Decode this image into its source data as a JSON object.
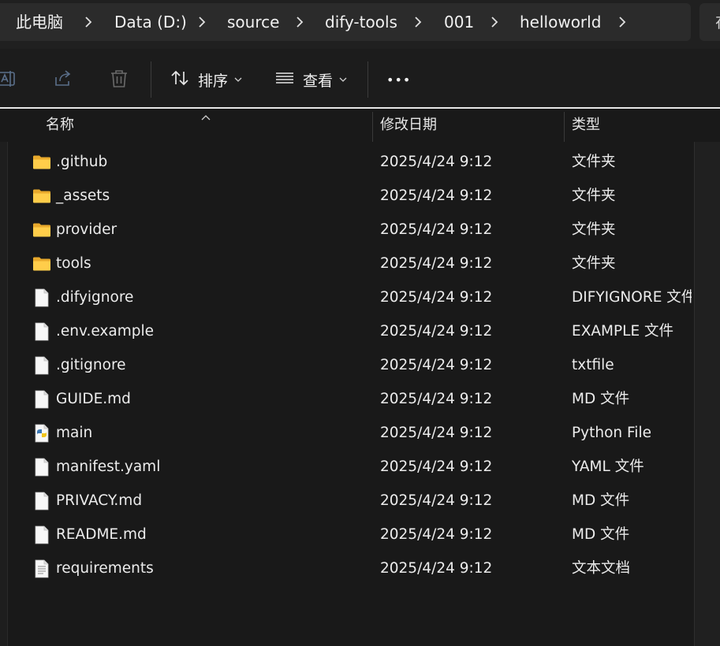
{
  "address": {
    "crumbs": [
      "此电脑",
      "Data (D:)",
      "source",
      "dify-tools",
      "001",
      "helloworld"
    ],
    "search_glyph": "在"
  },
  "toolbar": {
    "rename_icon": "rename-icon",
    "share_icon": "share-icon",
    "delete_icon": "trash-icon",
    "sort_label": "排序",
    "view_label": "查看",
    "more_label": "•••"
  },
  "columns": {
    "name": "名称",
    "date": "修改日期",
    "type": "类型"
  },
  "files": [
    {
      "name": ".github",
      "date": "2025/4/24 9:12",
      "type": "文件夹",
      "icon": "folder-icon"
    },
    {
      "name": "_assets",
      "date": "2025/4/24 9:12",
      "type": "文件夹",
      "icon": "folder-icon"
    },
    {
      "name": "provider",
      "date": "2025/4/24 9:12",
      "type": "文件夹",
      "icon": "folder-icon"
    },
    {
      "name": "tools",
      "date": "2025/4/24 9:12",
      "type": "文件夹",
      "icon": "folder-icon"
    },
    {
      "name": ".difyignore",
      "date": "2025/4/24 9:12",
      "type": "DIFYIGNORE 文件",
      "icon": "file-icon"
    },
    {
      "name": ".env.example",
      "date": "2025/4/24 9:12",
      "type": "EXAMPLE 文件",
      "icon": "file-icon"
    },
    {
      "name": ".gitignore",
      "date": "2025/4/24 9:12",
      "type": "txtfile",
      "icon": "file-icon"
    },
    {
      "name": "GUIDE.md",
      "date": "2025/4/24 9:12",
      "type": "MD 文件",
      "icon": "file-icon"
    },
    {
      "name": "main",
      "date": "2025/4/24 9:12",
      "type": "Python File",
      "icon": "python-file-icon"
    },
    {
      "name": "manifest.yaml",
      "date": "2025/4/24 9:12",
      "type": "YAML 文件",
      "icon": "file-icon"
    },
    {
      "name": "PRIVACY.md",
      "date": "2025/4/24 9:12",
      "type": "MD 文件",
      "icon": "file-icon"
    },
    {
      "name": "README.md",
      "date": "2025/4/24 9:12",
      "type": "MD 文件",
      "icon": "file-icon"
    },
    {
      "name": "requirements",
      "date": "2025/4/24 9:12",
      "type": "文本文档",
      "icon": "text-document-icon"
    }
  ]
}
